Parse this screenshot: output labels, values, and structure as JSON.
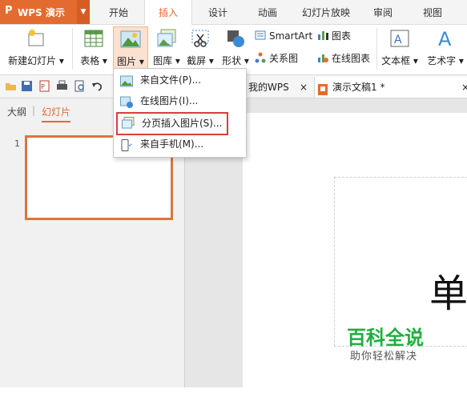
{
  "app": {
    "name": "WPS 演示",
    "logo": "P"
  },
  "menu_tabs": [
    "开始",
    "插入",
    "设计",
    "动画",
    "幻灯片放映",
    "审阅",
    "视图"
  ],
  "active_tab": "插入",
  "ribbon": {
    "new_slide": "新建幻灯片",
    "table": "表格",
    "picture": "图片",
    "gallery": "图库",
    "screenshot": "截屏",
    "shapes": "形状",
    "smartart": "SmartArt",
    "chart": "图表",
    "relation_chart": "关系图",
    "online_chart": "在线图表",
    "textbox": "文本框",
    "wordart": "艺术字"
  },
  "doc_tabs": [
    {
      "label": "我的WPS",
      "close": "×"
    },
    {
      "label": "演示文稿1 *",
      "close": "×"
    }
  ],
  "left_panel": {
    "tab_outline": "大纲",
    "divider": "|",
    "tab_slides": "幻灯片",
    "slide_number": "1"
  },
  "dropdown": {
    "items": [
      {
        "label": "来自文件(P)...",
        "icon": "picture-file-icon"
      },
      {
        "label": "在线图片(I)...",
        "icon": "online-picture-icon"
      },
      {
        "label": "分页插入图片(S)...",
        "icon": "paged-insert-picture-icon",
        "highlighted": true
      },
      {
        "label": "来自手机(M)...",
        "icon": "phone-icon"
      }
    ]
  },
  "slide_content": {
    "title_char": "单"
  },
  "watermark": {
    "title": "百科全说",
    "subtitle": "助你轻松解决"
  },
  "colors": {
    "accent": "#e36b2f",
    "highlight_border": "#d6403e",
    "watermark_green": "#1fae3f"
  }
}
